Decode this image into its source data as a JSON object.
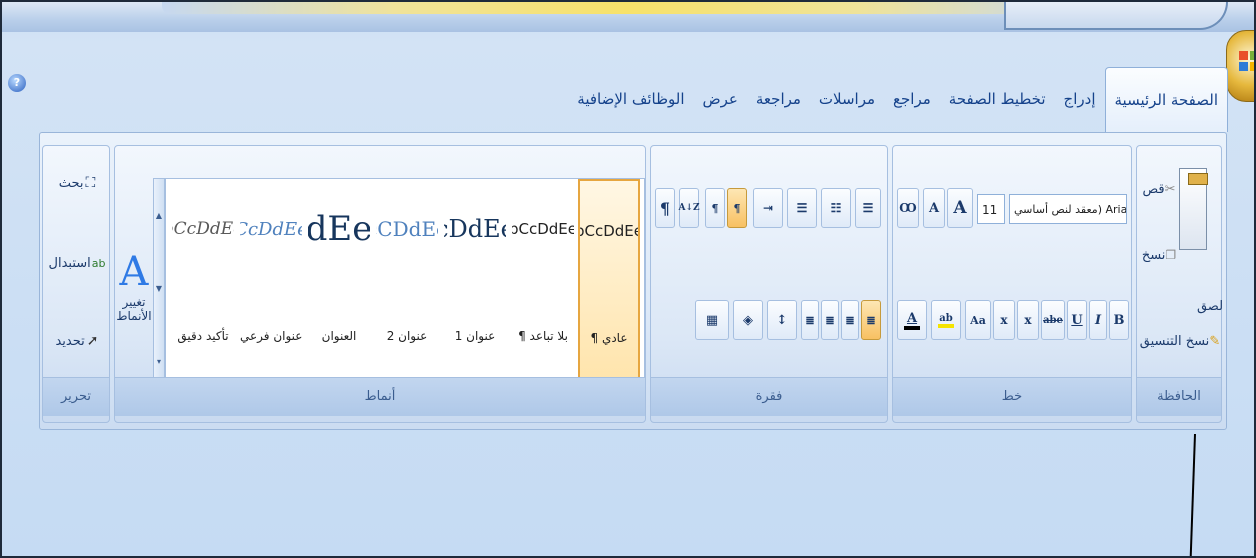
{
  "window": {
    "help_glyph": "?"
  },
  "tabs": [
    {
      "label": "الصفحة الرئيسية",
      "active": true
    },
    {
      "label": "إدراج"
    },
    {
      "label": "تخطيط الصفحة"
    },
    {
      "label": "مراجع"
    },
    {
      "label": "مراسلات"
    },
    {
      "label": "مراجعة"
    },
    {
      "label": "عرض"
    },
    {
      "label": "الوظائف الإضافية"
    }
  ],
  "clipboard": {
    "group_label": "الحافظة",
    "paste_label": "لصق",
    "cut_label": "قص",
    "copy_label": "نسخ",
    "format_painter_label": "نسخ التنسيق"
  },
  "font": {
    "group_label": "خط",
    "font_name": "معقد لنص أساسي) Arial",
    "font_size": "11",
    "grow_font": "A",
    "shrink_font": "A",
    "clear_format_glyph": "Ꝏ",
    "bold": "B",
    "italic": "I",
    "underline": "U",
    "strikethrough": "abe",
    "subscript": "x",
    "superscript": "x",
    "change_case": "Aa",
    "highlight_glyph": "ab",
    "font_color_glyph": "A"
  },
  "paragraph": {
    "group_label": "فقرة",
    "show_marks": "¶",
    "sort": "A↓Z",
    "ltr": "¶",
    "rtl": "¶"
  },
  "styles": {
    "group_label": "أنماط",
    "change_styles_label": "تغيير الأنماط",
    "items": [
      {
        "sample": "bCcDdEe",
        "name": "¶ عادي",
        "active": true
      },
      {
        "sample": "bCcDdEe",
        "name": "¶ بلا تباعد"
      },
      {
        "sample": "cDdEe",
        "name": "عنوان 1"
      },
      {
        "sample": "cCDdEe",
        "name": "عنوان 2"
      },
      {
        "sample": "dEe",
        "name": "العنوان"
      },
      {
        "sample": "CcDdEe",
        "name": "عنوان فرعي"
      },
      {
        "sample": "bCcDdEe",
        "name": "تأكيد دقيق"
      }
    ]
  },
  "editing": {
    "group_label": "تحرير",
    "find_label": "بحث",
    "replace_label": "استبدال",
    "select_label": "تحديد"
  },
  "colors": {
    "highlight": "#f5e400",
    "font_color": "#000000"
  }
}
